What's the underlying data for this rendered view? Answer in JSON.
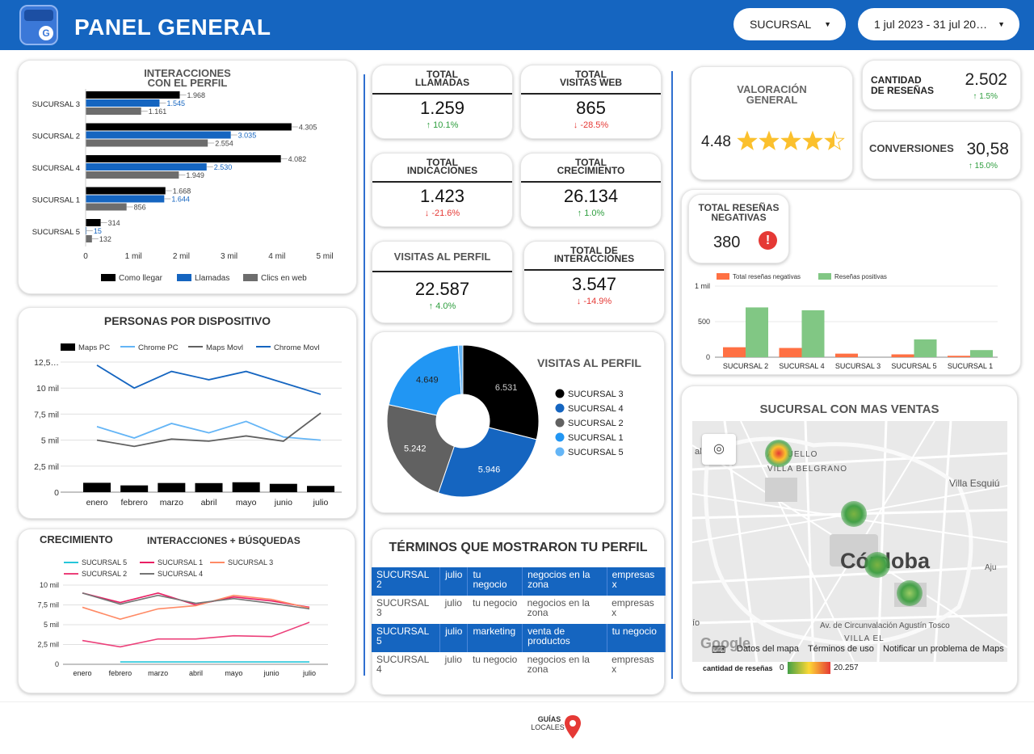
{
  "header": {
    "title": "PANEL GENERAL",
    "branch_select": "SUCURSAL",
    "date_range": "1 jul 2023 - 31 jul 20…"
  },
  "colors": {
    "header": "#1565c0",
    "black": "#000000",
    "blue": "#1565c0",
    "gray": "#6d6d6d",
    "orange": "#ff7043",
    "green": "#81c784"
  },
  "interacciones": {
    "title_l1": "INTERACCIONES",
    "title_l2": "CON EL PERFIL",
    "chart_data": {
      "type": "bar",
      "orientation": "horizontal",
      "categories": [
        "SUCURSAL 3",
        "SUCURSAL 2",
        "SUCURSAL 4",
        "SUCURSAL 1",
        "SUCURSAL 5"
      ],
      "series": [
        {
          "name": "Como llegar",
          "values": [
            1968,
            4305,
            4082,
            1668,
            314
          ]
        },
        {
          "name": "Llamadas",
          "values": [
            1545,
            3035,
            2530,
            1644,
            15
          ]
        },
        {
          "name": "Clics en web",
          "values": [
            1161,
            2554,
            1949,
            856,
            132
          ]
        }
      ],
      "value_labels": [
        [
          "1.968",
          "1.545",
          "1.161"
        ],
        [
          "4.305",
          "3.035",
          "2.554"
        ],
        [
          "4.082",
          "2.530",
          "1.949"
        ],
        [
          "1.668",
          "1.644",
          "856"
        ],
        [
          "314",
          "15",
          "132"
        ]
      ],
      "xticks": [
        "0",
        "1 mil",
        "2 mil",
        "3 mil",
        "4 mil",
        "5 mil"
      ],
      "xlim": [
        0,
        5000
      ],
      "legend": "bottom"
    }
  },
  "dispositivo": {
    "title": "PERSONAS POR DISPOSITIVO",
    "chart_data": {
      "type": "line",
      "categories": [
        "enero",
        "febrero",
        "marzo",
        "abril",
        "mayo",
        "junio",
        "julio"
      ],
      "series": [
        {
          "name": "Maps PC",
          "kind": "bar",
          "values": [
            900,
            650,
            880,
            870,
            950,
            800,
            600
          ]
        },
        {
          "name": "Chrome PC",
          "values": [
            6300,
            5200,
            6600,
            5700,
            6800,
            5300,
            5000
          ]
        },
        {
          "name": "Maps Movl",
          "values": [
            5000,
            4400,
            5100,
            4900,
            5400,
            4900,
            7600
          ]
        },
        {
          "name": "Chrome Movl",
          "values": [
            12200,
            10000,
            11600,
            10800,
            11600,
            10500,
            9400
          ]
        }
      ],
      "yticks": [
        "0",
        "2,5 mil",
        "5 mil",
        "7,5 mil",
        "10 mil",
        "12,5…"
      ],
      "ylim": [
        0,
        12500
      ],
      "legend": "top"
    }
  },
  "crecimiento": {
    "title": "CRECIMIENTO",
    "subtitle": "INTERACCIONES + BÚSQUEDAS",
    "chart_data": {
      "type": "line",
      "categories": [
        "enero",
        "febrero",
        "marzo",
        "abril",
        "mayo",
        "junio",
        "julio"
      ],
      "series": [
        {
          "name": "SUCURSAL 5",
          "values": [
            null,
            300,
            300,
            300,
            300,
            300,
            300
          ]
        },
        {
          "name": "SUCURSAL 1",
          "values": [
            9000,
            7800,
            9000,
            7500,
            8500,
            8000,
            7200
          ]
        },
        {
          "name": "SUCURSAL 3",
          "values": [
            7200,
            5700,
            7000,
            7400,
            8700,
            8200,
            7100
          ]
        },
        {
          "name": "SUCURSAL 2",
          "values": [
            3000,
            2200,
            3200,
            3200,
            3600,
            3500,
            5300
          ]
        },
        {
          "name": "SUCURSAL 4",
          "values": [
            9000,
            7600,
            8700,
            7700,
            8300,
            7700,
            7000
          ]
        }
      ],
      "yticks": [
        "0",
        "2,5 mil",
        "5 mil",
        "7,5 mil",
        "10 mil"
      ],
      "ylim": [
        0,
        10000
      ],
      "legend": "top"
    }
  },
  "kpis": [
    {
      "t1": "TOTAL",
      "t2": "LLAMADAS",
      "value": "1.259",
      "delta": "↑ 10.1%",
      "dir": "up"
    },
    {
      "t1": "TOTAL",
      "t2": "VISITAS WEB",
      "value": "865",
      "delta": "↓ -28.5%",
      "dir": "down"
    },
    {
      "t1": "TOTAL",
      "t2": "INDICACIONES",
      "value": "1.423",
      "delta": "↓ -21.6%",
      "dir": "down"
    },
    {
      "t1": "TOTAL",
      "t2": "CRECIMIENTO",
      "value": "26.134",
      "delta": "↑ 1.0%",
      "dir": "up"
    },
    {
      "t1": "VISITAS AL PERFIL",
      "t2": "",
      "value": "22.587",
      "delta": "↑ 4.0%",
      "dir": "up"
    },
    {
      "t1": "TOTAL DE",
      "t2": "INTERACCIONES",
      "value": "3.547",
      "delta": "↓ -14.9%",
      "dir": "down"
    }
  ],
  "visitas": {
    "title": "VISITAS AL PERFIL",
    "chart_data": {
      "type": "pie",
      "donut": true,
      "labels": [
        "SUCURSAL 3",
        "SUCURSAL 4",
        "SUCURSAL 2",
        "SUCURSAL 1",
        "SUCURSAL 5"
      ],
      "values": [
        6531,
        5946,
        5242,
        4649,
        219
      ],
      "value_labels": [
        "6.531",
        "5.946",
        "5.242",
        "4.649",
        ""
      ],
      "colors": [
        "#000000",
        "#1565c0",
        "#616161",
        "#2196f3",
        "#64b5f6"
      ],
      "legend": "right"
    }
  },
  "terminos": {
    "title": "TÉRMINOS QUE MOSTRARON TU PERFIL",
    "rows": [
      [
        "SUCURSAL 2",
        "julio",
        "tu negocio",
        "negocios en la zona",
        "empresas x"
      ],
      [
        "SUCURSAL 3",
        "julio",
        "tu negocio",
        "negocios en la zona",
        "empresas x"
      ],
      [
        "SUCURSAL 5",
        "julio",
        "marketing",
        "venta de productos",
        "tu negocio"
      ],
      [
        "SUCURSAL 4",
        "julio",
        "tu negocio",
        "negocios en la zona",
        "empresas x"
      ]
    ]
  },
  "valoracion": {
    "t1": "VALORACIÓN",
    "t2": "GENERAL",
    "value": "4.48",
    "stars": 4.48
  },
  "resenas": {
    "t1": "CANTIDAD",
    "t2": "DE RESEÑAS",
    "value": "2.502",
    "delta": "↑ 1.5%"
  },
  "conversiones": {
    "label": "CONVERSIONES",
    "value": "30,58",
    "delta": "↑ 15.0%"
  },
  "negativas": {
    "t1": "TOTAL RESEÑAS",
    "t2": "NEGATIVAS",
    "value": "380",
    "alert_icon": "alert-icon",
    "chart_data": {
      "type": "bar",
      "categories": [
        "SUCURSAL 2",
        "SUCURSAL 4",
        "SUCURSAL 3",
        "SUCURSAL 5",
        "SUCURSAL 1"
      ],
      "series": [
        {
          "name": "Total reseñas negativas",
          "values": [
            140,
            130,
            50,
            40,
            20
          ]
        },
        {
          "name": "Reseñas positivas",
          "values": [
            700,
            660,
            0,
            250,
            100
          ]
        }
      ],
      "yticks": [
        "0",
        "500",
        "1 mil"
      ],
      "ylim": [
        0,
        1000
      ],
      "legend": "top"
    }
  },
  "mapa": {
    "title": "SUCURSAL CON MAS VENTAS",
    "city": "Córdoba",
    "places": [
      "ARGUELLO",
      "VILLA BELGRANO",
      "Villa Esquiú",
      "Av. de Circunvalación Agustín Tosco",
      "VILLA EL",
      "Aju",
      "ío",
      "al"
    ],
    "google": "Google",
    "footer": [
      "Datos del mapa",
      "Términos de uso",
      "Notificar un problema de Maps"
    ],
    "legend_label": "cantidad de reseñas",
    "legend_min": "0",
    "legend_max": "20.257"
  },
  "footer": {
    "logo_l1": "GUÍAS",
    "logo_l2": "LOCALES"
  }
}
